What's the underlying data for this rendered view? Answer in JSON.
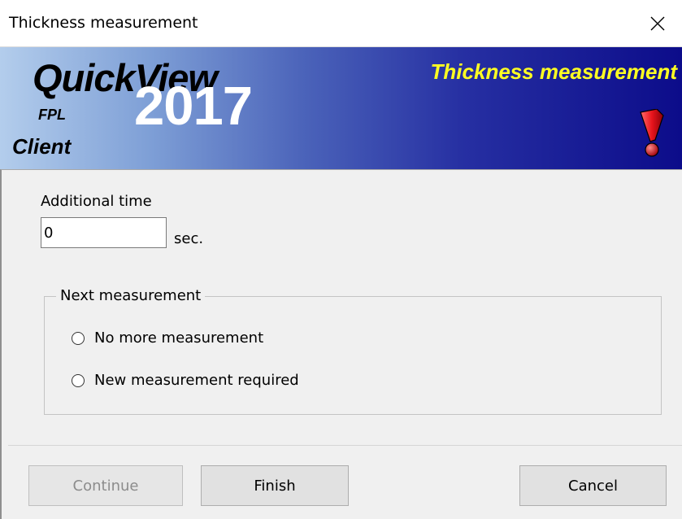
{
  "window": {
    "title": "Thickness measurement",
    "close_glyph": "✕"
  },
  "banner": {
    "brand_name": "QuickView",
    "brand_year": "2017",
    "brand_sub": "FPL",
    "brand_role": "Client",
    "title": "Thickness measurement",
    "alert_icon": "exclamation-icon",
    "colors": {
      "gradient_start": "#b3cdec",
      "gradient_end": "#0c0c8a",
      "title_color": "#ffff22",
      "alert_color": "#e8141c"
    }
  },
  "form": {
    "additional_time_label": "Additional time",
    "additional_time_value": "0",
    "unit": "sec.",
    "group_label": "Next measurement",
    "options": [
      {
        "label": "No more measurement",
        "selected": false
      },
      {
        "label": "New measurement required",
        "selected": false
      }
    ]
  },
  "buttons": {
    "continue": {
      "label": "Continue",
      "enabled": false
    },
    "finish": {
      "label": "Finish",
      "enabled": true
    },
    "cancel": {
      "label": "Cancel",
      "enabled": true
    }
  }
}
